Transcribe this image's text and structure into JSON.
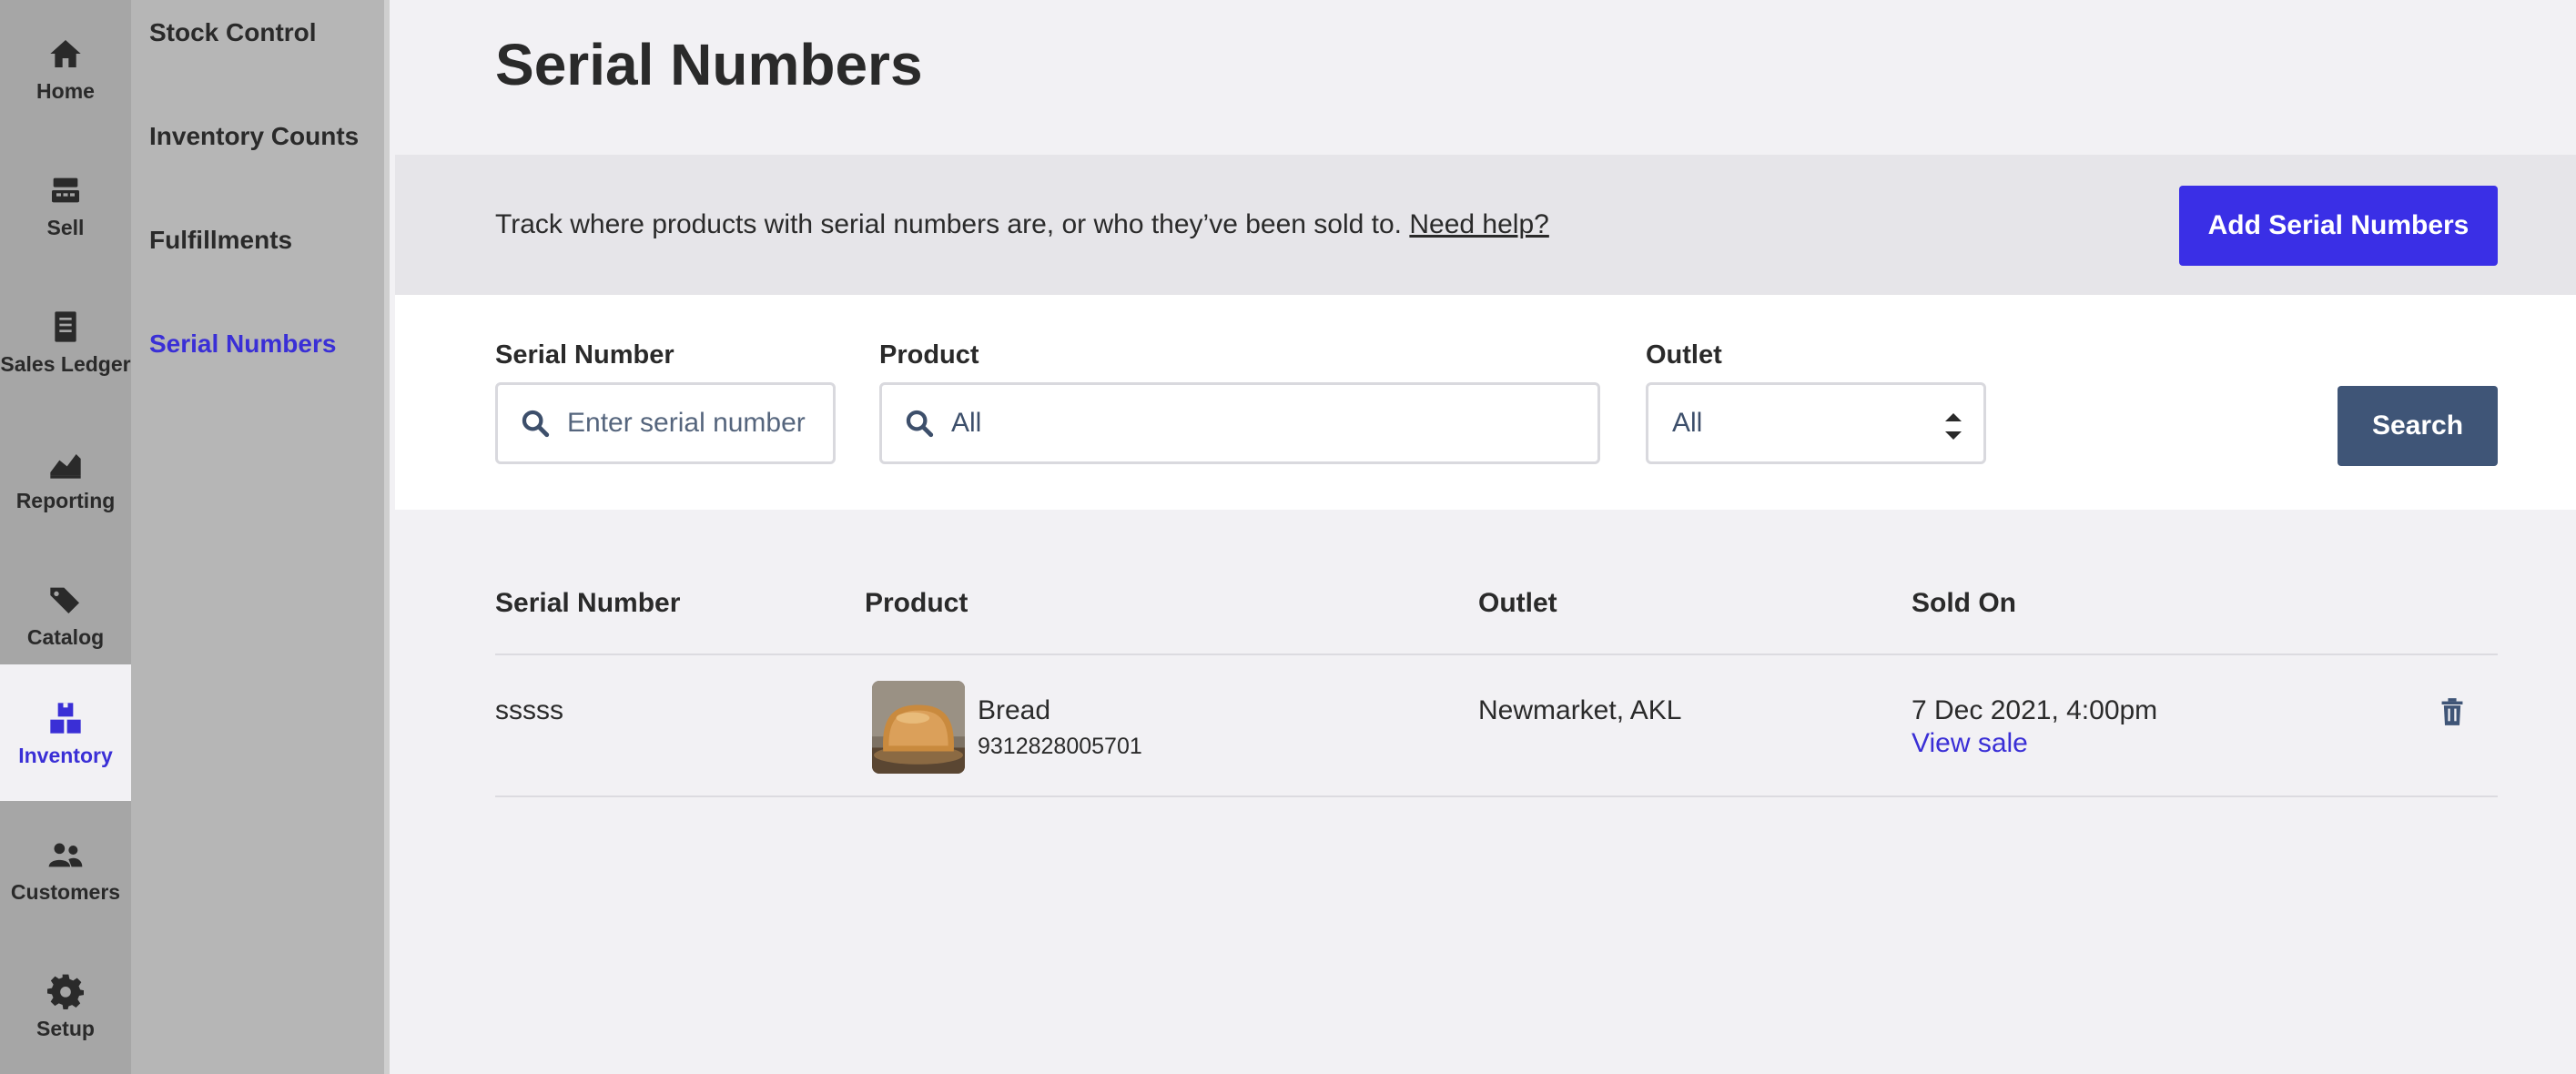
{
  "rail": {
    "items": [
      {
        "label": "Home",
        "icon": "home-icon"
      },
      {
        "label": "Sell",
        "icon": "register-icon"
      },
      {
        "label": "Sales Ledger",
        "icon": "ledger-icon"
      },
      {
        "label": "Reporting",
        "icon": "chart-icon"
      },
      {
        "label": "Catalog",
        "icon": "tags-icon"
      },
      {
        "label": "Inventory",
        "icon": "boxes-icon",
        "active": true
      },
      {
        "label": "Customers",
        "icon": "people-icon"
      },
      {
        "label": "Setup",
        "icon": "gear-icon"
      }
    ]
  },
  "subnav": {
    "items": [
      {
        "label": "Stock Control"
      },
      {
        "label": "Inventory Counts"
      },
      {
        "label": "Fulfillments"
      },
      {
        "label": "Serial Numbers",
        "active": true
      }
    ]
  },
  "page": {
    "title": "Serial Numbers",
    "banner_text": "Track where products with serial numbers are, or who they’ve been sold to.",
    "help_link": "Need help?",
    "add_button": "Add Serial Numbers"
  },
  "filters": {
    "serial_label": "Serial Number",
    "serial_placeholder": "Enter serial number",
    "product_label": "Product",
    "product_value": "All",
    "outlet_label": "Outlet",
    "outlet_value": "All",
    "search_button": "Search"
  },
  "table": {
    "columns": [
      "Serial Number",
      "Product",
      "Outlet",
      "Sold On"
    ],
    "rows": [
      {
        "serial": "sssss",
        "product_name": "Bread",
        "product_sku": "9312828005701",
        "outlet": "Newmarket, AKL",
        "sold_on": "7 Dec 2021, 4:00pm",
        "sale_link": "View sale"
      }
    ]
  },
  "colors": {
    "accent": "#3a2fe6",
    "search_button": "#3f5577",
    "active_nav": "#3a2fd6"
  }
}
